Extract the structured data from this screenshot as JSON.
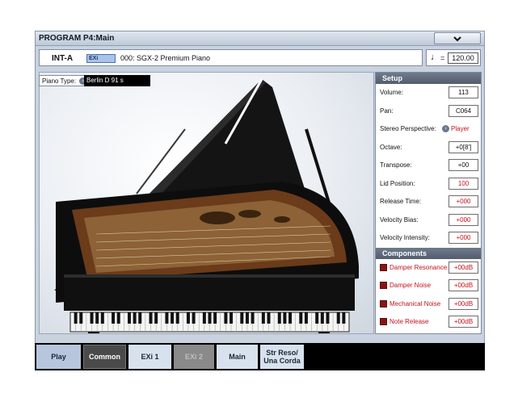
{
  "window": {
    "title": "PROGRAM P4:Main"
  },
  "info": {
    "bank": "INT-A",
    "engine_tag": "EXi",
    "program_name": "000: SGX-2 Premium Piano"
  },
  "tempo": {
    "symbol": "♩",
    "equals": "=",
    "value": "120.00"
  },
  "piano_type": {
    "label": "Piano Type:",
    "value": "Berlin D 91 s"
  },
  "setup": {
    "heading": "Setup",
    "rows": [
      {
        "label": "Volume:",
        "value": "113",
        "value_red": false
      },
      {
        "label": "Pan:",
        "value": "C064",
        "value_red": false
      },
      {
        "label": "Stereo Perspective:",
        "value": "Player",
        "value_red": true
      },
      {
        "label": "Octave:",
        "value": "+0[8']",
        "value_red": false
      },
      {
        "label": "Transpose:",
        "value": "+00",
        "value_red": false
      },
      {
        "label": "Lid Position:",
        "value": "100",
        "value_red": true
      },
      {
        "label": "Release Time:",
        "value": "+000",
        "value_red": true
      },
      {
        "label": "Velocity Bias:",
        "value": "+000",
        "value_red": true
      },
      {
        "label": "Velocity Intensity:",
        "value": "+000",
        "value_red": true
      }
    ]
  },
  "components": {
    "heading": "Components",
    "rows": [
      {
        "label": "Damper Resonance",
        "value": "+00dB"
      },
      {
        "label": "Damper Noise",
        "value": "+00dB"
      },
      {
        "label": "Mechanical Noise",
        "value": "+00dB"
      },
      {
        "label": "Note Release",
        "value": "+00dB"
      }
    ]
  },
  "tabs": [
    {
      "label": "Play"
    },
    {
      "label": "Common"
    },
    {
      "label": "EXi 1"
    },
    {
      "label": "EXi 2"
    },
    {
      "label": "Main"
    },
    {
      "label": "Str Reso/\nUna Corda"
    }
  ],
  "icons": {
    "menu": "chevron-down-icon",
    "arrow": "arrow-right-icon",
    "checkbox": "checkbox-icon"
  }
}
